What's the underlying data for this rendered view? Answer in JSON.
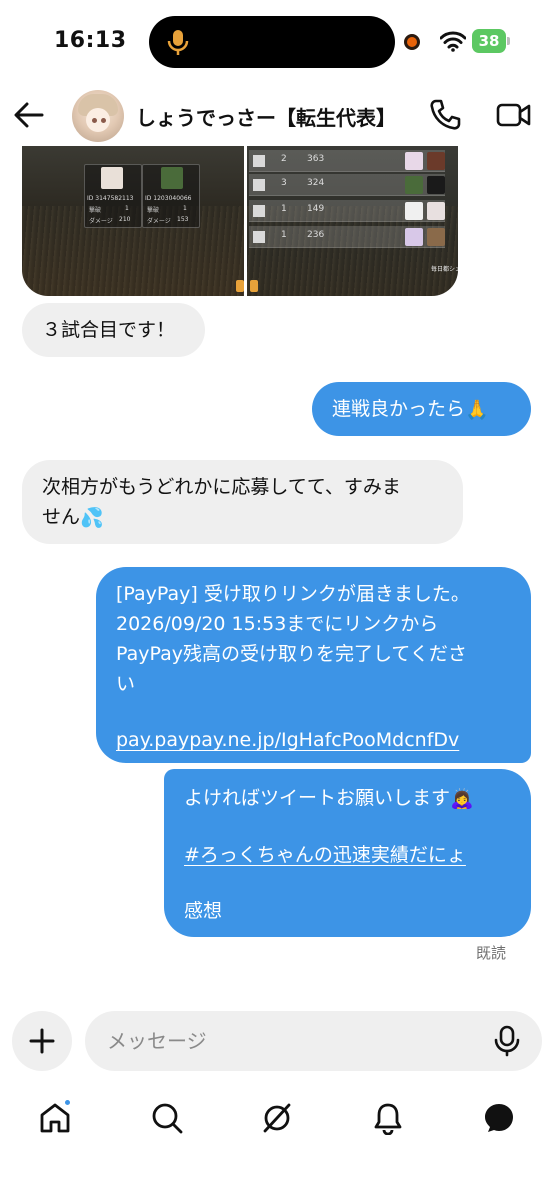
{
  "status_bar": {
    "time": "16:13",
    "battery": "38"
  },
  "header": {
    "contact_name": "しょうでっさー【転生代表】",
    "icons": [
      "back-arrow-icon",
      "phone-icon",
      "video-camera-icon"
    ]
  },
  "media": {
    "left_card_1": {
      "id": "ID 3147582113",
      "rank_label": "撃破",
      "rank_value": "1",
      "damage_label": "ダメージ",
      "damage_value": "210"
    },
    "left_card_2": {
      "id": "ID 1203040066",
      "rank_label": "撃破",
      "rank_value": "1",
      "damage_label": "ダメージ",
      "damage_value": "153"
    },
    "right_rows": [
      {
        "rank": "2",
        "score": "363"
      },
      {
        "rank": "3",
        "score": "324"
      },
      {
        "rank": "1",
        "score": "149"
      },
      {
        "rank": "1",
        "score": "236"
      }
    ],
    "right_footer": "毎日都シェア"
  },
  "messages": [
    {
      "id": "m1",
      "direction": "in",
      "text": "３試合目です！"
    },
    {
      "id": "m2",
      "direction": "out",
      "text": "連戦良かったら",
      "emoji": "🙏"
    },
    {
      "id": "m3",
      "direction": "in",
      "line1": "次相方がもうどれかに応募してて、すみま",
      "line2": "せん",
      "emoji": "💦"
    },
    {
      "id": "m4",
      "direction": "out",
      "line1": "[PayPay] 受け取りリンクが届きました。",
      "line2": "2026/09/20 15:53までにリンクから",
      "line3": "PayPay残高の受け取りを完了してくださ",
      "line4": "い",
      "link": "pay.paypay.ne.jp/IgHafcPooMdcnfDv"
    },
    {
      "id": "m5",
      "direction": "out",
      "line1": "よければツイートお願いします",
      "emoji": "🙇‍♀️",
      "hashtag": "#ろっくちゃんの迅速実績だにょ",
      "line3": "感想"
    }
  ],
  "read_receipt": "既読",
  "composer": {
    "placeholder": "メッセージ",
    "value": ""
  },
  "bottom_nav": [
    "home-icon",
    "search-icon",
    "explore-icon",
    "notifications-icon",
    "messages-icon"
  ],
  "colors": {
    "accent": "#3d94e6",
    "incoming_bubble": "#efefef",
    "battery": "#5cc862",
    "recording": "#e8630a"
  }
}
